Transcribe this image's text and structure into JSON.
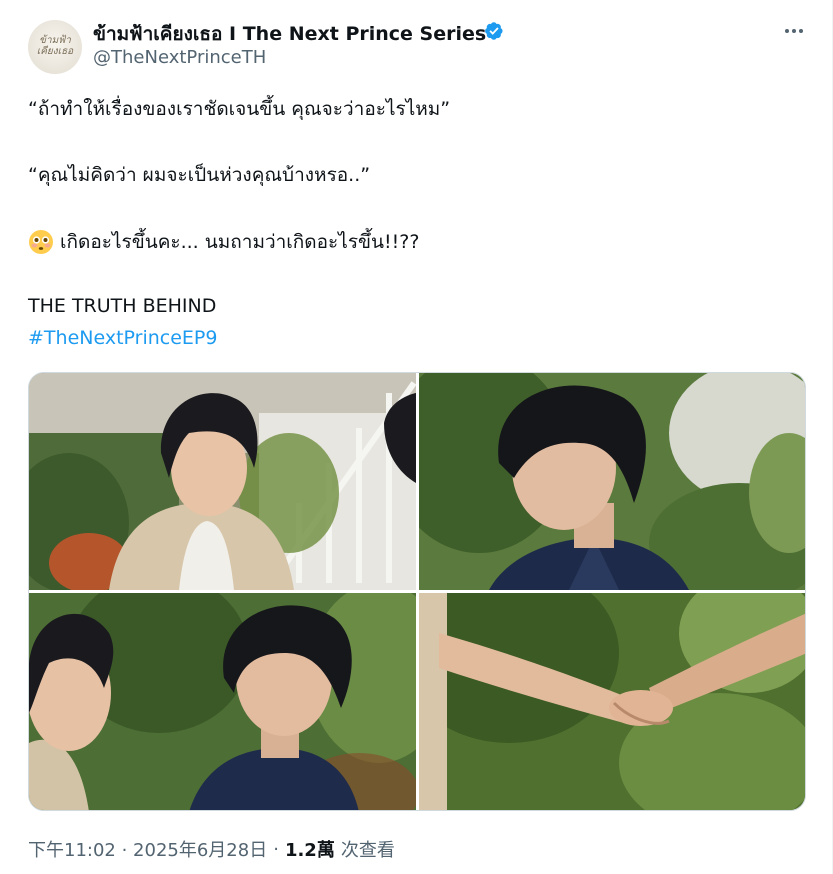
{
  "author": {
    "display_name": "ข้ามฟ้าเคียงเธอ I The Next Prince Series",
    "handle": "@TheNextPrinceTH",
    "avatar_logo_line1": "ข้ามฟ้า",
    "avatar_logo_line2": "เคียงเธอ",
    "verified": true
  },
  "tweet": {
    "line1": "“ถ้าทำให้เรื่องของเราชัดเจนขึ้น คุณจะว่าอะไรไหม”",
    "line2": "“คุณไม่คิดว่า ผมจะเป็นห่วงคุณบ้างหรอ..”",
    "line3": "เกิดอะไรขึ้นคะ... นมถามว่าเกิดอะไรขึ้น!!??",
    "line3_emoji": "flushed-face-emoji",
    "line4": "THE TRUTH BEHIND",
    "hashtag": "#TheNextPrinceEP9"
  },
  "meta": {
    "time": "下午11:02 · 2025年6月28日",
    "separator": "·",
    "views_count": "1.2萬",
    "views_label": "次查看"
  },
  "media": {
    "photo_count": 4
  },
  "colors": {
    "text_primary": "#0f1419",
    "text_secondary": "#536471",
    "accent": "#1d9bf0",
    "border": "#cfd9de"
  }
}
